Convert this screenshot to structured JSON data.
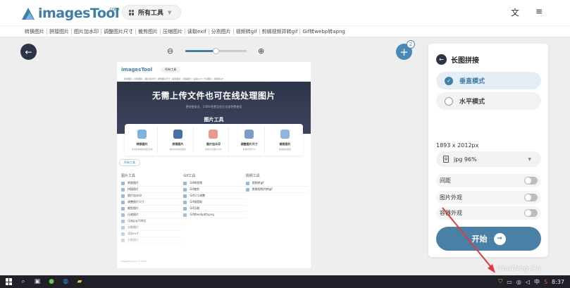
{
  "header": {
    "logo_text": "imagesTool",
    "logo_suffix": "com",
    "all_tools_label": "所有工具",
    "translate_icon": "translate-icon",
    "menu_icon": "hamburger-menu-icon"
  },
  "nav": {
    "items": [
      "转换图片",
      "拼接图片",
      "图片加水印",
      "调整图片尺寸",
      "裁剪图片",
      "压缩图片",
      "读取exif",
      "分割图片",
      "视频转gif",
      "剪辑视频并转gif",
      "Gif转webp转apng"
    ]
  },
  "toolbar": {
    "back_icon": "arrow-left-icon",
    "zoom_out_label": "⊖",
    "zoom_in_label": "⊕",
    "zoom_level": 0.5,
    "add_count": "2"
  },
  "preview": {
    "logo_text": "imagesTool",
    "pill_label": "所有工具",
    "nav_text": "转换图片 | 拼接图片 | 图片加水印 | 调整图片尺寸 | 裁剪图片 | 压缩图片 | 读取exif | 分割图片 | 视频转gif",
    "hero_title": "无需上传文件也可在线处理图片",
    "hero_sub": "更快更安全，100%免费且往后全部免费使用",
    "section_title": "图片工具",
    "cards": [
      {
        "label": "转换图片",
        "desc": "支持多种格式相互转换",
        "color": "#7fb2dc"
      },
      {
        "label": "拼接图片",
        "desc": "横向纵向拼接图片",
        "color": "#4a6fa5"
      },
      {
        "label": "图片加水印",
        "desc": "添加文字图片水印",
        "color": "#e89a8c"
      },
      {
        "label": "调整图片尺寸",
        "desc": "批量调整尺寸",
        "color": "#7c9cc7"
      },
      {
        "label": "裁剪图片",
        "desc": "自由裁剪图片",
        "color": "#8fb4e0"
      }
    ],
    "all_tools_label": "所有工具",
    "columns": [
      {
        "title": "图片工具",
        "rows": [
          "转换图片",
          "拼接图片",
          "图片加水印",
          "调整图片尺寸",
          "裁剪图片",
          "压缩图片",
          "压缩jpg不降低",
          "分割图片",
          "读取exif",
          "分割图片"
        ]
      },
      {
        "title": "Gif工具",
        "rows": [
          "Gif转视频",
          "Gif裁剪",
          "Gif尺寸调整",
          "Gif帧提取",
          "Gif压缩",
          "Gif转webp转apng"
        ]
      },
      {
        "title": "视频工具",
        "rows": [
          "视频转gif",
          "剪辑视频并转gif"
        ]
      }
    ],
    "footer": "ImagesTool.com © 2023"
  },
  "panel": {
    "title": "长图拼接",
    "back_icon": "arrow-left-icon",
    "modes": [
      {
        "label": "垂直模式",
        "selected": true
      },
      {
        "label": "水平模式",
        "selected": false
      }
    ],
    "dimensions": "1893 x 2012px",
    "format_label": "jpg 96%",
    "toggles": [
      {
        "label": "间距",
        "on": false
      },
      {
        "label": "图片外观",
        "on": false
      },
      {
        "label": "容器外观",
        "on": false
      }
    ],
    "start_label": "开始"
  },
  "watermark": "iHaiBlog.Cn",
  "taskbar": {
    "time": "8:37",
    "ime": "中",
    "tray_icons": [
      "shield-icon",
      "network-icon",
      "globe-icon",
      "volume-icon",
      "ime-icon"
    ]
  },
  "colors": {
    "accent": "#3f7ea6",
    "start_button": "#4a7fa6",
    "dark": "#2d3447",
    "annotation": "#e23b3b"
  }
}
